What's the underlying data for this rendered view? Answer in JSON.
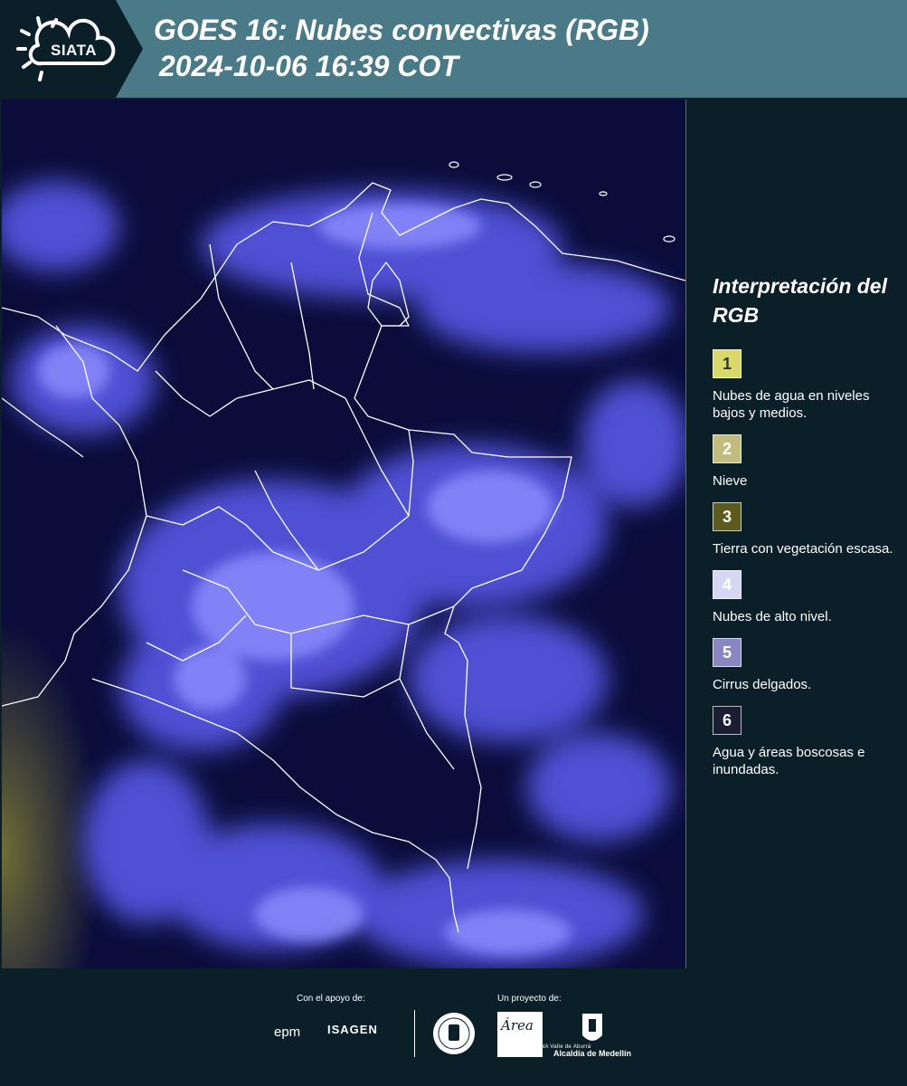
{
  "header": {
    "logo_text": "SIATA",
    "title": "GOES 16: Nubes convectivas (RGB)",
    "datetime": "2024-10-06 16:39 COT",
    "band_color": "#4a7988"
  },
  "map": {
    "cloud_color": "#6a6cff",
    "background_color": "#0a0d3a",
    "border_color": "#ffffff"
  },
  "legend": {
    "title": "Interpretación del RGB",
    "items": [
      {
        "number": "1",
        "label": "Nubes de agua en niveles bajos y medios.",
        "color": "#d9d86a",
        "text_color": "#333333"
      },
      {
        "number": "2",
        "label": "Nieve",
        "color": "#c2bd7e",
        "text_color": "#ffffff"
      },
      {
        "number": "3",
        "label": "Tierra con vegetación escasa.",
        "color": "#5b5a1f",
        "text_color": "#ffffff"
      },
      {
        "number": "4",
        "label": "Nubes de alto nivel.",
        "color": "#d6d6f5",
        "text_color": "#ffffff"
      },
      {
        "number": "5",
        "label": "Cirrus delgados.",
        "color": "#8a86c2",
        "text_color": "#ffffff"
      },
      {
        "number": "6",
        "label": "Agua y áreas boscosas e inundadas.",
        "color": "#1b1e33",
        "text_color": "#ffffff"
      }
    ]
  },
  "footer": {
    "support_label": "Con el apoyo de:",
    "project_label": "Un proyecto de:",
    "sponsor_1": "epm",
    "sponsor_2": "ISAGEN",
    "area_logo_text": "Área",
    "area_logo_sub": "METROPOLITANA Valle de Aburrá",
    "alcaldia_label": "Alcaldía de Medellín"
  }
}
